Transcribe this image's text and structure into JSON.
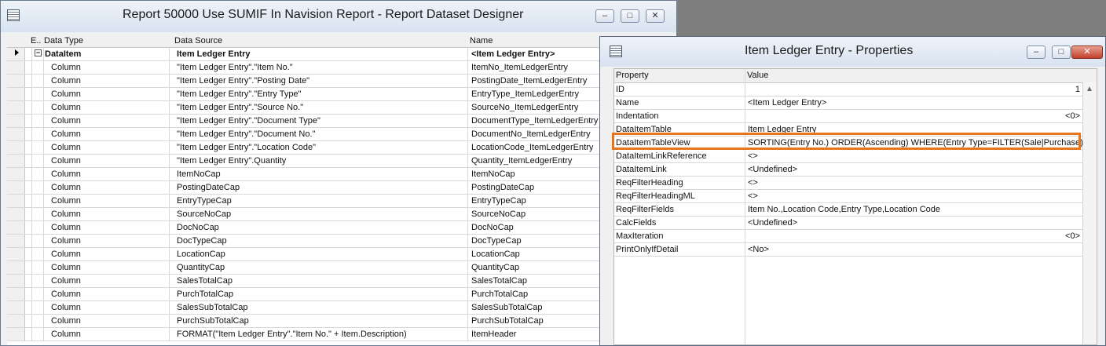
{
  "designer": {
    "title": "Report 50000 Use SUMIF In Navision Report - Report Dataset Designer",
    "minimize": "–",
    "maximize": "□",
    "close": "✕",
    "columns": [
      "E..",
      "Data Type",
      "Data Source",
      "Name"
    ],
    "top_row": {
      "type": "DataItem",
      "source": "Item Ledger Entry",
      "name": "<Item Ledger Entry>",
      "expand_symbol": "−"
    },
    "rows": [
      {
        "type": "Column",
        "source": "\"Item Ledger Entry\".\"Item No.\"",
        "name": "ItemNo_ItemLedgerEntry"
      },
      {
        "type": "Column",
        "source": "\"Item Ledger Entry\".\"Posting Date\"",
        "name": "PostingDate_ItemLedgerEntry"
      },
      {
        "type": "Column",
        "source": "\"Item Ledger Entry\".\"Entry Type\"",
        "name": "EntryType_ItemLedgerEntry"
      },
      {
        "type": "Column",
        "source": "\"Item Ledger Entry\".\"Source No.\"",
        "name": "SourceNo_ItemLedgerEntry"
      },
      {
        "type": "Column",
        "source": "\"Item Ledger Entry\".\"Document Type\"",
        "name": "DocumentType_ItemLedgerEntry"
      },
      {
        "type": "Column",
        "source": "\"Item Ledger Entry\".\"Document No.\"",
        "name": "DocumentNo_ItemLedgerEntry"
      },
      {
        "type": "Column",
        "source": "\"Item Ledger Entry\".\"Location Code\"",
        "name": "LocationCode_ItemLedgerEntry"
      },
      {
        "type": "Column",
        "source": "\"Item Ledger Entry\".Quantity",
        "name": "Quantity_ItemLedgerEntry"
      },
      {
        "type": "Column",
        "source": "ItemNoCap",
        "name": "ItemNoCap"
      },
      {
        "type": "Column",
        "source": "PostingDateCap",
        "name": "PostingDateCap"
      },
      {
        "type": "Column",
        "source": "EntryTypeCap",
        "name": "EntryTypeCap"
      },
      {
        "type": "Column",
        "source": "SourceNoCap",
        "name": "SourceNoCap"
      },
      {
        "type": "Column",
        "source": "DocNoCap",
        "name": "DocNoCap"
      },
      {
        "type": "Column",
        "source": "DocTypeCap",
        "name": "DocTypeCap"
      },
      {
        "type": "Column",
        "source": "LocationCap",
        "name": "LocationCap"
      },
      {
        "type": "Column",
        "source": "QuantityCap",
        "name": "QuantityCap"
      },
      {
        "type": "Column",
        "source": "SalesTotalCap",
        "name": "SalesTotalCap"
      },
      {
        "type": "Column",
        "source": "PurchTotalCap",
        "name": "PurchTotalCap"
      },
      {
        "type": "Column",
        "source": "SalesSubTotalCap",
        "name": "SalesSubTotalCap"
      },
      {
        "type": "Column",
        "source": "PurchSubTotalCap",
        "name": "PurchSubTotalCap"
      },
      {
        "type": "Column",
        "source": "FORMAT(\"Item Ledger Entry\".\"Item No.\" + Item.Description)",
        "name": "ItemHeader"
      }
    ]
  },
  "properties": {
    "title": "Item Ledger Entry - Properties",
    "minimize": "–",
    "maximize": "□",
    "close": "✕",
    "columns": [
      "Property",
      "Value"
    ],
    "rows": [
      {
        "property": "ID",
        "value": "",
        "right_value": "1"
      },
      {
        "property": "Name",
        "value": "<Item Ledger Entry>",
        "right_value": ""
      },
      {
        "property": "Indentation",
        "value": "",
        "right_value": "<0>"
      },
      {
        "property": "DataItemTable",
        "value": "Item Ledger Entry",
        "right_value": ""
      },
      {
        "property": "DataItemTableView",
        "value": "SORTING(Entry No.) ORDER(Ascending) WHERE(Entry Type=FILTER(Sale|Purchase))",
        "right_value": ""
      },
      {
        "property": "DataItemLinkReference",
        "value": "<>",
        "right_value": ""
      },
      {
        "property": "DataItemLink",
        "value": "<Undefined>",
        "right_value": ""
      },
      {
        "property": "ReqFilterHeading",
        "value": "<>",
        "right_value": ""
      },
      {
        "property": "ReqFilterHeadingML",
        "value": "<>",
        "right_value": ""
      },
      {
        "property": "ReqFilterFields",
        "value": "Item No.,Location Code,Entry Type,Location Code",
        "right_value": ""
      },
      {
        "property": "CalcFields",
        "value": "<Undefined>",
        "right_value": ""
      },
      {
        "property": "MaxIteration",
        "value": "",
        "right_value": "<0>"
      },
      {
        "property": "PrintOnlyIfDetail",
        "value": "<No>",
        "right_value": ""
      }
    ],
    "highlighted_property": "DataItemTableView",
    "highlight_color": "#e8741c"
  }
}
